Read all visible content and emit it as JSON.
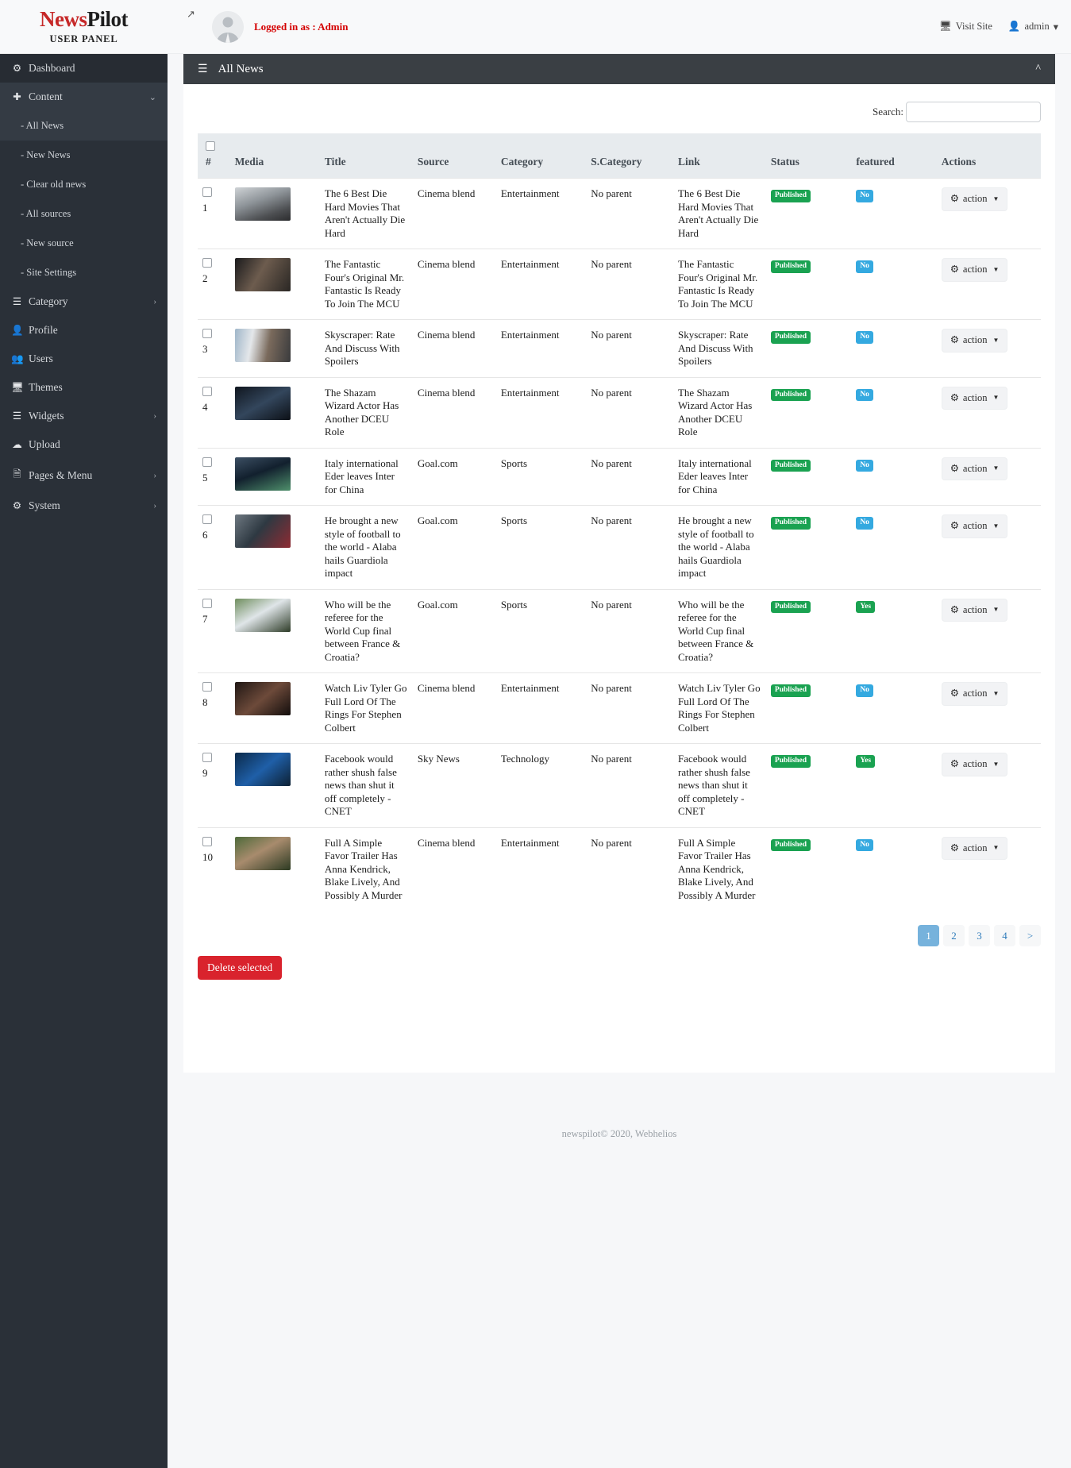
{
  "brand": {
    "name_part1": "News",
    "name_part2": "Pilot",
    "subtitle": "USER PANEL"
  },
  "sidebar": {
    "items": [
      {
        "label": "Dashboard",
        "icon": "dashboard-icon",
        "glyph": "⛭"
      },
      {
        "label": "Content",
        "icon": "plus-circle-icon",
        "glyph": "⊕",
        "chevron": "⌄"
      },
      {
        "label": "Category",
        "icon": "list-icon",
        "glyph": "☰",
        "chevron": "›"
      },
      {
        "label": "Profile",
        "icon": "user-icon",
        "glyph": "♟"
      },
      {
        "label": "Users",
        "icon": "users-icon",
        "glyph": "♟♟"
      },
      {
        "label": "Themes",
        "icon": "monitor-icon",
        "glyph": "▢"
      },
      {
        "label": "Widgets",
        "icon": "widgets-icon",
        "glyph": "☰",
        "chevron": "›"
      },
      {
        "label": "Upload",
        "icon": "cloud-upload-icon",
        "glyph": "☁"
      },
      {
        "label": "Pages & Menu",
        "icon": "file-icon",
        "glyph": "❐",
        "chevron": "›"
      },
      {
        "label": "System",
        "icon": "gear-icon",
        "glyph": "⚙",
        "chevron": "›"
      }
    ],
    "content_subitems": [
      "- All News",
      "- New News",
      "- Clear old news",
      "- All sources",
      "- New source",
      "- Site Settings"
    ]
  },
  "topbar": {
    "expand_icon": "expand-arrows-icon",
    "logged_in_text": "Logged in as : Admin",
    "visit_site": "Visit Site",
    "admin_label": "admin",
    "caret": "▾"
  },
  "panel": {
    "title": "All News",
    "collapse_icon": "chevron-up-icon"
  },
  "search": {
    "label": "Search:",
    "value": "",
    "placeholder": ""
  },
  "table": {
    "headers": [
      "#",
      "Media",
      "Title",
      "Source",
      "Category",
      "S.Category",
      "Link",
      "Status",
      "featured",
      "Actions"
    ],
    "action_label": "action",
    "rows": [
      {
        "num": "1",
        "title": "The 6 Best Die Hard Movies That Aren't Actually Die Hard",
        "source": "Cinema blend",
        "category": "Entertainment",
        "scategory": "No parent",
        "link": "The 6 Best Die Hard Movies That Aren't Actually Die Hard",
        "status": "Published",
        "featured": "No",
        "thumb": "die-hard-gym"
      },
      {
        "num": "2",
        "title": "The Fantastic Four's Original Mr. Fantastic Is Ready To Join The MCU",
        "source": "Cinema blend",
        "category": "Entertainment",
        "scategory": "No parent",
        "link": "The Fantastic Four's Original Mr. Fantastic Is Ready To Join The MCU",
        "status": "Published",
        "featured": "No",
        "thumb": "fantastic-four"
      },
      {
        "num": "3",
        "title": "Skyscraper: Rate And Discuss With Spoilers",
        "source": "Cinema blend",
        "category": "Entertainment",
        "scategory": "No parent",
        "link": "Skyscraper: Rate And Discuss With Spoilers",
        "status": "Published",
        "featured": "No",
        "thumb": "skyscraper"
      },
      {
        "num": "4",
        "title": "The Shazam Wizard Actor Has Another DCEU Role",
        "source": "Cinema blend",
        "category": "Entertainment",
        "scategory": "No parent",
        "link": "The Shazam Wizard Actor Has Another DCEU Role",
        "status": "Published",
        "featured": "No",
        "thumb": "shazam"
      },
      {
        "num": "5",
        "title": "Italy international Eder leaves Inter for China",
        "source": "Goal.com",
        "category": "Sports",
        "scategory": "No parent",
        "link": "Italy international Eder leaves Inter for China",
        "status": "Published",
        "featured": "No",
        "thumb": "eder-inter"
      },
      {
        "num": "6",
        "title": "He brought a new style of football to the world - Alaba hails Guardiola impact",
        "source": "Goal.com",
        "category": "Sports",
        "scategory": "No parent",
        "link": "He brought a new style of football to the world - Alaba hails Guardiola impact",
        "status": "Published",
        "featured": "No",
        "thumb": "guardiola-alaba"
      },
      {
        "num": "7",
        "title": "Who will be the referee for the World Cup final between France & Croatia?",
        "source": "Goal.com",
        "category": "Sports",
        "scategory": "No parent",
        "link": "Who will be the referee for the World Cup final between France & Croatia?",
        "status": "Published",
        "featured": "Yes",
        "thumb": "referee"
      },
      {
        "num": "8",
        "title": "Watch Liv Tyler Go Full Lord Of The Rings For Stephen Colbert",
        "source": "Cinema blend",
        "category": "Entertainment",
        "scategory": "No parent",
        "link": "Watch Liv Tyler Go Full Lord Of The Rings For Stephen Colbert",
        "status": "Published",
        "featured": "No",
        "thumb": "liv-tyler"
      },
      {
        "num": "9",
        "title": "Facebook would rather shush false news than shut it off completely - CNET",
        "source": "Sky News",
        "category": "Technology",
        "scategory": "No parent",
        "link": "Facebook would rather shush false news than shut it off completely - CNET",
        "status": "Published",
        "featured": "Yes",
        "thumb": "facebook"
      },
      {
        "num": "10",
        "title": "Full A Simple Favor Trailer Has Anna Kendrick, Blake Lively, And Possibly A Murder",
        "source": "Cinema blend",
        "category": "Entertainment",
        "scategory": "No parent",
        "link": "Full A Simple Favor Trailer Has Anna Kendrick, Blake Lively, And Possibly A Murder",
        "status": "Published",
        "featured": "No",
        "thumb": "simple-favor"
      }
    ]
  },
  "pagination": {
    "pages": [
      "1",
      "2",
      "3",
      "4",
      ">"
    ],
    "active": "1"
  },
  "delete_button": {
    "label": "Delete selected"
  },
  "footer": {
    "text": "newspilot© 2020, Webhelios"
  },
  "colors": {
    "sidebar_bg": "#2a3038",
    "panel_head_bg": "#3a3f44",
    "status_green": "#1aa251",
    "featured_blue": "#34a9e0",
    "danger_red": "#d9232d",
    "pager_active": "#76b2dc",
    "logged_text": "#d40000"
  }
}
